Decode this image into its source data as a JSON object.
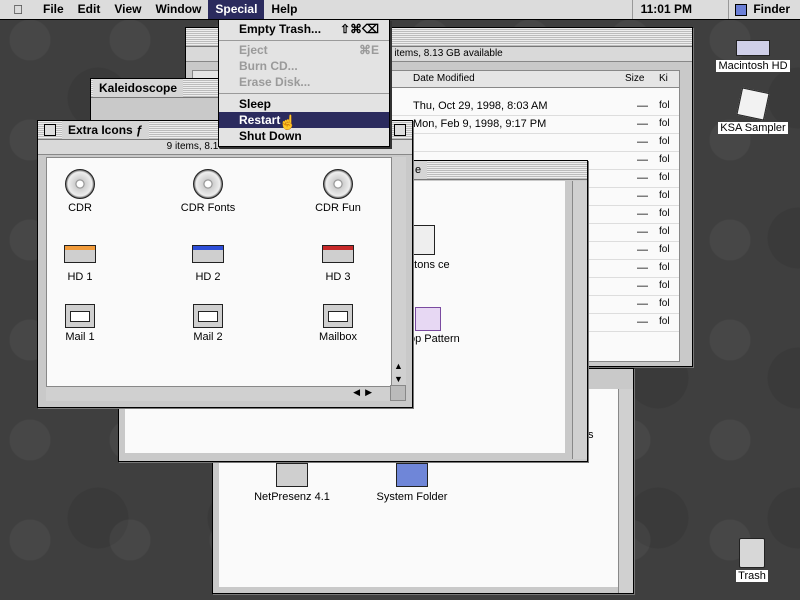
{
  "menubar": {
    "apple": "",
    "items": [
      "File",
      "Edit",
      "View",
      "Window",
      "Special",
      "Help"
    ],
    "clock": "11:01 PM",
    "app": "Finder"
  },
  "special_menu": {
    "empty_trash": "Empty Trash...",
    "empty_trash_kbd": "⇧⌘⌫",
    "eject": "Eject",
    "eject_kbd": "⌘E",
    "burn_cd": "Burn CD...",
    "erase_disk": "Erase Disk...",
    "sleep": "Sleep",
    "restart": "Restart",
    "shut_down": "Shut Down"
  },
  "back_window": {
    "info": "1 items, 8.13 GB available",
    "columns": {
      "date": "Date Modified",
      "size": "Size",
      "kind": "Ki"
    },
    "rows": [
      {
        "date": "Thu, Oct 29, 1998, 8:03 AM",
        "size": "—",
        "kind": "fol"
      },
      {
        "date": "Mon, Feb 9, 1998, 9:17 PM",
        "size": "—",
        "kind": "fol"
      }
    ],
    "kind_fill": "fol",
    "dash": "—"
  },
  "kaleidoscope_window": {
    "title": "Kaleidoscope"
  },
  "extra_icons_window": {
    "title": "Extra Icons ƒ",
    "info": "9 items, 8.13 GB available",
    "icons": [
      {
        "label": "CDR",
        "icon": "cd-icon"
      },
      {
        "label": "CDR Fonts",
        "icon": "cd-icon"
      },
      {
        "label": "CDR Fun",
        "icon": "cd-icon"
      },
      {
        "label": "HD 1",
        "icon": "hard-disk-icon"
      },
      {
        "label": "HD 2",
        "icon": "hard-disk-icon"
      },
      {
        "label": "HD 3",
        "icon": "hard-disk-icon"
      },
      {
        "label": "Mail 1",
        "icon": "mail-icon"
      },
      {
        "label": "Mail 2",
        "icon": "mail-icon"
      },
      {
        "label": "Mailbox",
        "icon": "mailbox-icon"
      }
    ]
  },
  "middle_window": {
    "label_buttons": "uttons ce",
    "label_pattern": "op Pattern",
    "title_fragment": "e"
  },
  "bottom_window": {
    "items": [
      {
        "label": "NetPresenz 4.1"
      },
      {
        "label": "System Folder"
      }
    ],
    "fragment": "s"
  },
  "desktop": {
    "icons": [
      {
        "label": "Macintosh HD"
      },
      {
        "label": "KSA Sampler"
      },
      {
        "label": "Trash"
      }
    ]
  },
  "colors": {
    "menu_highlight": "#2b2b5e",
    "desktop": "#3f3f3f"
  }
}
